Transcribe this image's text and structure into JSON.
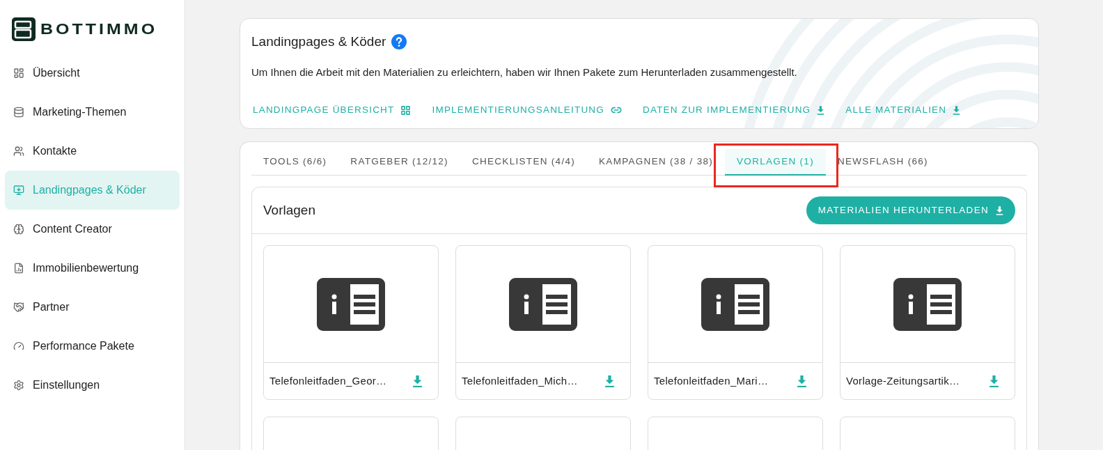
{
  "logo": {
    "text": "BOTTIMMO"
  },
  "sidebar": {
    "items": [
      {
        "label": "Übersicht",
        "selected": false
      },
      {
        "label": "Marketing-Themen",
        "selected": false
      },
      {
        "label": "Kontakte",
        "selected": false
      },
      {
        "label": "Landingpages & Köder",
        "selected": true
      },
      {
        "label": "Content Creator",
        "selected": false
      },
      {
        "label": "Immobilienbewertung",
        "selected": false
      },
      {
        "label": "Partner",
        "selected": false
      },
      {
        "label": "Performance Pakete",
        "selected": false
      },
      {
        "label": "Einstellungen",
        "selected": false
      }
    ]
  },
  "header": {
    "title": "Landingpages & Köder",
    "description": "Um Ihnen die Arbeit mit den Materialien zu erleichtern, haben wir Ihnen Pakete zum Herunterladen zusammengestellt.",
    "links": [
      {
        "label": "LANDINGPAGE ÜBERSICHT"
      },
      {
        "label": "IMPLEMENTIERUNGSANLEITUNG"
      },
      {
        "label": "DATEN ZUR IMPLEMENTIERUNG"
      },
      {
        "label": "ALLE MATERIALIEN"
      }
    ]
  },
  "tabs": [
    {
      "label": "TOOLS (6/6)",
      "selected": false,
      "highlighted": false
    },
    {
      "label": "RATGEBER (12/12)",
      "selected": false,
      "highlighted": false
    },
    {
      "label": "CHECKLISTEN (4/4)",
      "selected": false,
      "highlighted": false
    },
    {
      "label": "KAMPAGNEN (38 / 38)",
      "selected": false,
      "highlighted": false
    },
    {
      "label": "VORLAGEN (1)",
      "selected": true,
      "highlighted": true
    },
    {
      "label": "NEWSFLASH (66)",
      "selected": false,
      "highlighted": false
    }
  ],
  "panel": {
    "title": "Vorlagen",
    "button": "MATERIALIEN HERUNTERLADEN",
    "cards": [
      {
        "name": "Telefonleitfaden_Geor…"
      },
      {
        "name": "Telefonleitfaden_Mich…"
      },
      {
        "name": "Telefonleitfaden_Mari…"
      },
      {
        "name": "Vorlage-Zeitungsartik…"
      }
    ]
  }
}
